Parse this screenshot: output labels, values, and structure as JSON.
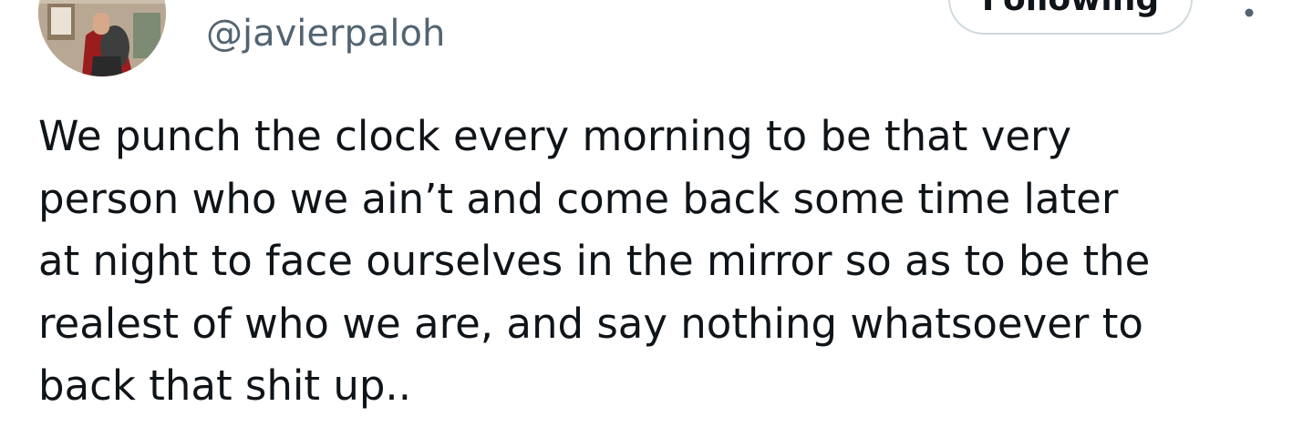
{
  "author": {
    "handle": "@javierpaloh"
  },
  "follow_button": {
    "label": "Following"
  },
  "more_button": {
    "icon": "more-vertical-icon"
  },
  "tweet": {
    "lines": [
      "We punch the clock every morning to be that very",
      "person who we ain’t and come back some time later",
      "at night to face ourselves in the mirror so as to be the",
      "realest of who we are, and say nothing whatsoever to",
      "back that shit up.."
    ]
  },
  "colors": {
    "text_primary": "#0f1419",
    "text_secondary": "#536471",
    "button_border": "#cfd9de",
    "avatar_bg": "#c9b8a2"
  }
}
